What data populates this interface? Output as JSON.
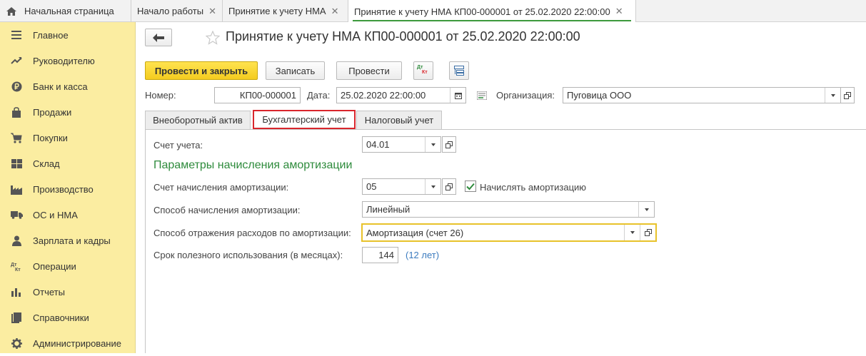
{
  "tabs": {
    "home": "Начальная страница",
    "start": "Начало работы",
    "nma": "Принятие к учету НМА",
    "doc": "Принятие к учету НМА КП00-000001 от 25.02.2020 22:00:00"
  },
  "sidebar": {
    "items": [
      {
        "label": "Главное",
        "icon": "menu-icon"
      },
      {
        "label": "Руководителю",
        "icon": "trend-icon"
      },
      {
        "label": "Банк и касса",
        "icon": "ruble-icon"
      },
      {
        "label": "Продажи",
        "icon": "bag-icon"
      },
      {
        "label": "Покупки",
        "icon": "cart-icon"
      },
      {
        "label": "Склад",
        "icon": "grid-icon"
      },
      {
        "label": "Производство",
        "icon": "factory-icon"
      },
      {
        "label": "ОС и НМА",
        "icon": "truck-icon"
      },
      {
        "label": "Зарплата и кадры",
        "icon": "person-icon"
      },
      {
        "label": "Операции",
        "icon": "dt-kt-icon"
      },
      {
        "label": "Отчеты",
        "icon": "bar-chart-icon"
      },
      {
        "label": "Справочники",
        "icon": "book-icon"
      },
      {
        "label": "Администрирование",
        "icon": "gear-icon"
      }
    ]
  },
  "header": {
    "title": "Принятие к учету НМА КП00-000001 от 25.02.2020 22:00:00"
  },
  "toolbar": {
    "post_close": "Провести и закрыть",
    "save": "Записать",
    "post": "Провести",
    "dtkt_top": "Дт",
    "dtkt_bottom": "Кт"
  },
  "form": {
    "number_label": "Номер:",
    "number_value": "КП00-000001",
    "date_label": "Дата:",
    "date_value": "25.02.2020 22:00:00",
    "org_label": "Организация:",
    "org_value": "Пуговица ООО"
  },
  "doc_tabs": {
    "asset": "Внеоборотный актив",
    "accounting": "Бухгалтерский учет",
    "tax": "Налоговый учет"
  },
  "accounting": {
    "account_label": "Счет учета:",
    "account_value": "04.01",
    "section_title": "Параметры начисления амортизации",
    "amort_account_label": "Счет начисления амортизации:",
    "amort_account_value": "05",
    "accrue_label": "Начислять амортизацию",
    "accrue_checked": true,
    "method_label": "Способ начисления амортизации:",
    "method_value": "Линейный",
    "expense_label": "Способ отражения расходов по амортизации:",
    "expense_value": "Амортизация (счет 26)",
    "term_label": "Срок полезного использования (в месяцах):",
    "term_value": "144",
    "term_years": "(12 лет)"
  },
  "colors": {
    "sidebar_bg": "#fbeda1",
    "primary_button": "#f4cc1f",
    "section_title": "#2e8b3c",
    "active_tab_border": "#d9262c",
    "focus_border": "#e8c22a",
    "link": "#3b7bbf"
  }
}
